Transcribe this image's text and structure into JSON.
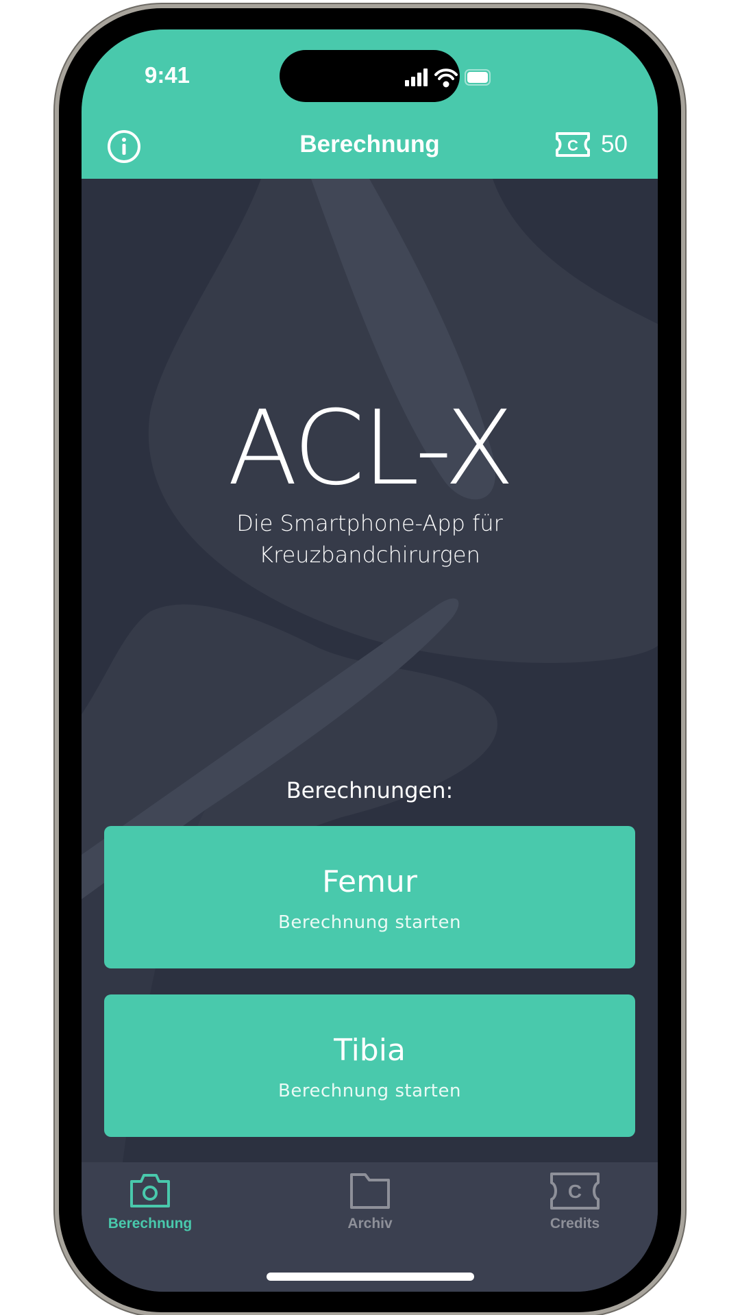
{
  "status_bar": {
    "time": "9:41",
    "icons": [
      "cellular-signal-icon",
      "wifi-icon",
      "battery-icon"
    ]
  },
  "header": {
    "title": "Berechnung",
    "info_icon": "info-icon",
    "credits_icon": "ticket-icon",
    "credits_count": "50"
  },
  "hero": {
    "logo": "ACL-X",
    "subtitle_line1": "Die Smartphone-App für",
    "subtitle_line2": "Kreuzbandchirurgen"
  },
  "calculations": {
    "label": "Berechnungen:",
    "buttons": [
      {
        "title": "Femur",
        "subtitle": "Berechnung starten"
      },
      {
        "title": "Tibia",
        "subtitle": "Berechnung starten"
      }
    ]
  },
  "tabbar": {
    "items": [
      {
        "label": "Berechnung",
        "icon": "camera-icon",
        "active": true
      },
      {
        "label": "Archiv",
        "icon": "folder-icon",
        "active": false
      },
      {
        "label": "Credits",
        "icon": "ticket-icon",
        "active": false
      }
    ]
  },
  "colors": {
    "accent": "#49c9ac",
    "background": "#2c3140",
    "tabbar": "#3b4050",
    "inactive": "#8e9099"
  }
}
